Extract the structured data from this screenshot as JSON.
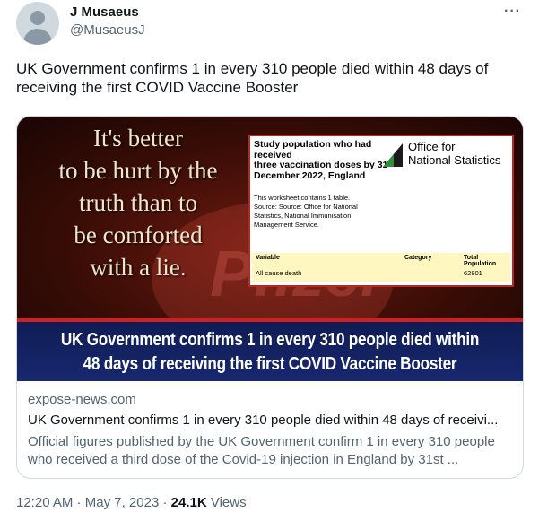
{
  "author": {
    "name": "J Musaeus",
    "handle": "@MusaeusJ"
  },
  "more_icon": "more-horizontal-icon",
  "tweet_text": "UK Government confirms 1 in every 310 people died within 48 days of receiving the first COVID Vaccine Booster",
  "card": {
    "image": {
      "quote_lines": [
        "It's  better",
        "to be hurt by the",
        "truth than to",
        "be comforted",
        "with a lie."
      ],
      "watermark": "Pfizer",
      "ons": {
        "title_lines": [
          "Study population who had",
          "received",
          "three vaccination doses by 31",
          "December 2022, England"
        ],
        "desc_lines": [
          "This worksheet contains 1 table.",
          "Source: Source: Office for National",
          "Statistics, National Immunisation",
          "Management Service."
        ],
        "logo_lines": [
          "Office for",
          "National Statistics"
        ],
        "table": {
          "headers": [
            "Variable",
            "Category",
            "Total Population"
          ],
          "row": [
            "All cause death",
            "",
            "62801"
          ]
        }
      },
      "banner_lines": [
        "UK Government confirms 1 in every 310 people died within",
        "48 days of receiving the first COVID Vaccine Booster"
      ]
    },
    "domain": "expose-news.com",
    "title": "UK Government confirms 1 in every 310 people died within 48 days of receivi...",
    "description": "Official figures published by the UK Government confirm 1 in every 310 people who received a third dose of the Covid-19 injection in England by 31st ..."
  },
  "meta": {
    "time": "12:20 AM",
    "sep1": " · ",
    "date": "May 7, 2023",
    "sep2": " · ",
    "views_count": "24.1K",
    "views_label": " Views"
  },
  "colors": {
    "text": "#0f1419",
    "secondary": "#536471",
    "border": "#cfd9de",
    "banner_blue": "#0f1c55",
    "banner_red": "#d21f1f"
  }
}
